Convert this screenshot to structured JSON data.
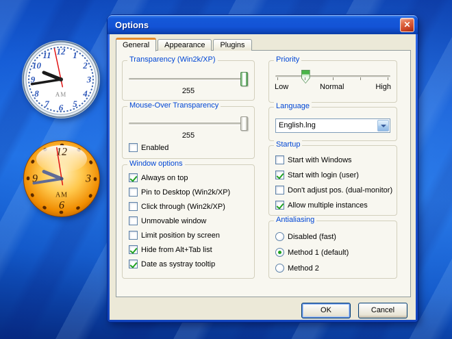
{
  "window": {
    "title": "Options"
  },
  "titlebar": {
    "close_glyph": "✕"
  },
  "tabs": {
    "general": "General",
    "appearance": "Appearance",
    "plugins": "Plugins"
  },
  "general_tab": {
    "transparency": {
      "caption": "Transparency (Win2k/XP)",
      "value": "255",
      "slider_percent": 100
    },
    "mouse_over": {
      "caption": "Mouse-Over Transparency",
      "value": "255",
      "slider_percent": 100,
      "enabled": {
        "label": "Enabled",
        "checked": false
      }
    },
    "window_options": {
      "caption": "Window options",
      "items": [
        {
          "label": "Always on top",
          "checked": true
        },
        {
          "label": "Pin to Desktop (Win2k/XP)",
          "checked": false
        },
        {
          "label": "Click through (Win2k/XP)",
          "checked": false
        },
        {
          "label": "Unmovable window",
          "checked": false
        },
        {
          "label": "Limit position by screen",
          "checked": false
        },
        {
          "label": "Hide from Alt+Tab list",
          "checked": true
        },
        {
          "label": "Date as systray tooltip",
          "checked": true
        }
      ]
    },
    "priority": {
      "caption": "Priority",
      "labels": {
        "low": "Low",
        "normal": "Normal",
        "high": "High"
      },
      "slider_percent": 26
    },
    "language": {
      "caption": "Language",
      "selected": "English.lng"
    },
    "startup": {
      "caption": "Startup",
      "items": [
        {
          "label": "Start with Windows",
          "checked": false
        },
        {
          "label": "Start with login (user)",
          "checked": true
        },
        {
          "label": "Don't adjust pos. (dual-monitor)",
          "checked": false
        },
        {
          "label": "Allow multiple instances",
          "checked": true
        }
      ]
    },
    "antialiasing": {
      "caption": "Antialiasing",
      "options": [
        {
          "label": "Disabled (fast)",
          "selected": false
        },
        {
          "label": "Method 1 (default)",
          "selected": true
        },
        {
          "label": "Method 2",
          "selected": false
        }
      ]
    }
  },
  "actions": {
    "ok": "OK",
    "cancel": "Cancel"
  },
  "desktop": {
    "clocks": {
      "silver": {
        "numerals": [
          "12",
          "1",
          "2",
          "3",
          "4",
          "5",
          "6",
          "7",
          "8",
          "9",
          "10",
          "11"
        ],
        "period": "AM",
        "time_shown": "9:43:58"
      },
      "orange": {
        "numerals": [
          "12",
          "3",
          "6",
          "9"
        ],
        "period": "AM",
        "time_shown": "9:43:58"
      }
    }
  },
  "colors": {
    "titlebar_blue": "#1C5BD8",
    "dialog_bg": "#ECE9D8",
    "tab_page_bg": "#F8F7F0",
    "caption_blue": "#0046D5",
    "check_green": "#1FA11F",
    "active_tab_accent": "#E68B2C",
    "close_red": "#CC4526",
    "wallpaper_blue": "#1E6FE4"
  }
}
